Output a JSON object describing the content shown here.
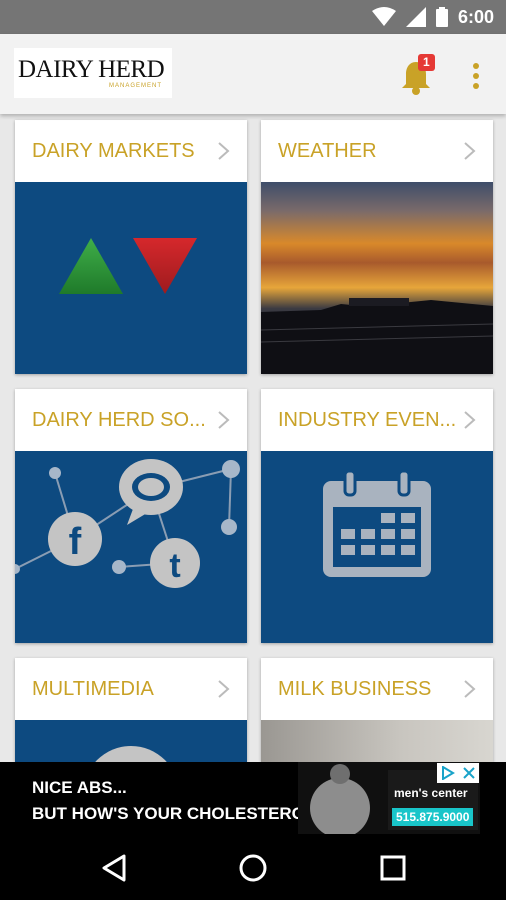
{
  "status_bar": {
    "time": "6:00",
    "icons": [
      "wifi-icon",
      "signal-icon",
      "battery-icon"
    ]
  },
  "app_bar": {
    "logo_text": "DAIRY HERD",
    "logo_subtext": "MANAGEMENT",
    "notification_count": "1"
  },
  "tiles": [
    {
      "title": "DAIRY MARKETS",
      "image": "up-down-arrows"
    },
    {
      "title": "WEATHER",
      "image": "sunset-photo"
    },
    {
      "title": "DAIRY HERD SO...",
      "image": "social-network"
    },
    {
      "title": "INDUSTRY EVEN...",
      "image": "calendar"
    },
    {
      "title": "MULTIMEDIA",
      "image": "multimedia"
    },
    {
      "title": "MILK BUSINESS",
      "image": "photo"
    }
  ],
  "ad": {
    "line1": "NICE ABS...",
    "line2": "BUT HOW'S YOUR CHOLESTEROL?",
    "brand_text": "men's center",
    "phone": "515.875.9000"
  },
  "colors": {
    "accent": "#c9a227",
    "tile_blue": "#0d4a80",
    "status_bar": "#757575",
    "badge": "#e53935"
  }
}
